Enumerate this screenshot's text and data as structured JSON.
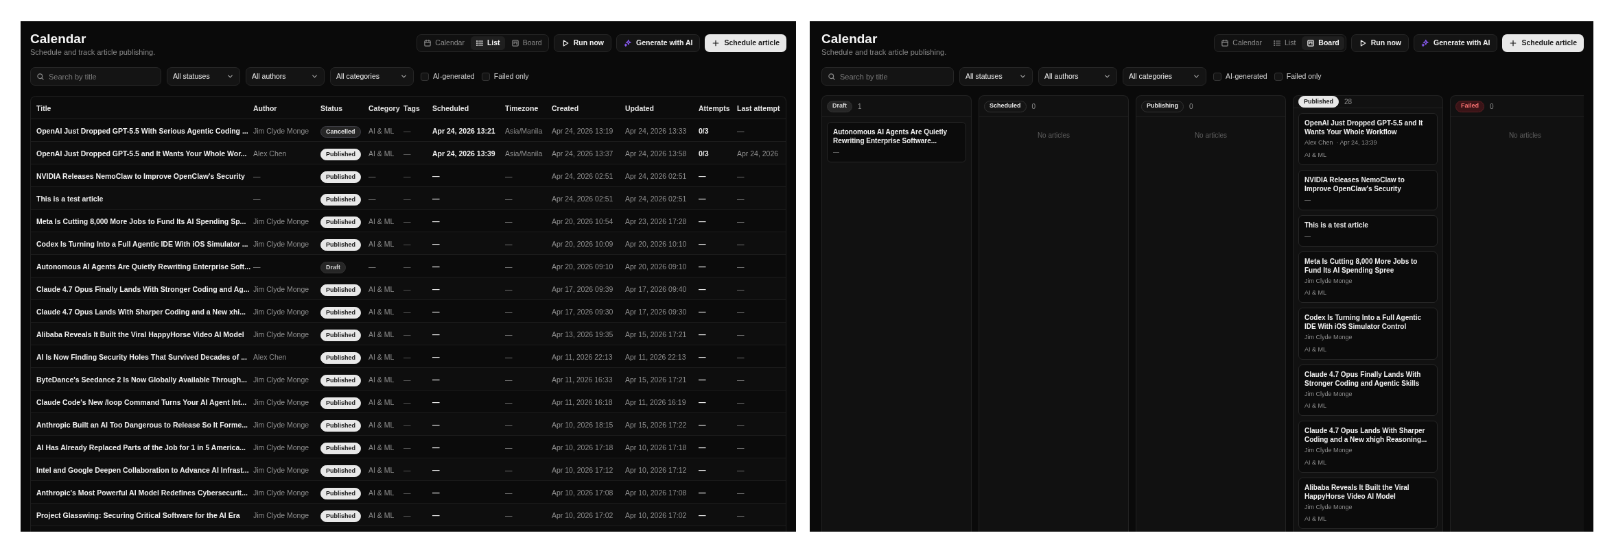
{
  "panels": [
    {
      "kind": "list",
      "header": {
        "title": "Calendar",
        "subtitle": "Schedule and track article publishing."
      },
      "view_tabs": [
        {
          "label": "Calendar",
          "selected": false
        },
        {
          "label": "List",
          "selected": true
        },
        {
          "label": "Board",
          "selected": false
        }
      ],
      "actions": [
        {
          "label": "Run now"
        },
        {
          "label": "Generate with AI"
        },
        {
          "label": "Schedule article"
        }
      ],
      "filters": {
        "search": {
          "placeholder": "Search by title"
        },
        "dropdowns": [
          {
            "value": "All statuses"
          },
          {
            "value": "All authors"
          },
          {
            "value": "All categories"
          }
        ],
        "checkboxes": [
          {
            "label": "AI-generated",
            "checked": false
          },
          {
            "label": "Failed only",
            "checked": false
          }
        ]
      },
      "table": {
        "columns": [
          "Title",
          "Author",
          "Status",
          "Category",
          "Tags",
          "Scheduled",
          "Timezone",
          "Created",
          "Updated",
          "Attempts",
          "Last attempt"
        ],
        "rows": [
          {
            "title": "OpenAI Just Dropped GPT-5.5 With Serious Agentic Coding ...",
            "author": "Jim Clyde Monge",
            "status": {
              "label": "Cancelled",
              "kind": "cancelled"
            },
            "category": "AI & ML",
            "tags": "—",
            "scheduled": "Apr 24, 2026 13:21",
            "timezone": "Asia/Manila",
            "created": "Apr 24, 2026 13:19",
            "updated": "Apr 24, 2026 13:33",
            "attempts": "0/3",
            "last_attempt": "—"
          },
          {
            "title": "OpenAI Just Dropped GPT-5.5 and It Wants Your Whole Wor...",
            "author": "Alex Chen",
            "status": {
              "label": "Published",
              "kind": "published"
            },
            "category": "AI & ML",
            "tags": "—",
            "scheduled": "Apr 24, 2026 13:39",
            "timezone": "Asia/Manila",
            "created": "Apr 24, 2026 13:37",
            "updated": "Apr 24, 2026 13:58",
            "attempts": "0/3",
            "last_attempt": "Apr 24, 2026"
          },
          {
            "title": "NVIDIA Releases NemoClaw to Improve OpenClaw's Security",
            "author": "—",
            "status": {
              "label": "Published",
              "kind": "published"
            },
            "category": "—",
            "tags": "—",
            "scheduled": "—",
            "timezone": "—",
            "created": "Apr 24, 2026 02:51",
            "updated": "Apr 24, 2026 02:51",
            "attempts": "—",
            "last_attempt": "—"
          },
          {
            "title": "This is a test article",
            "author": "—",
            "status": {
              "label": "Published",
              "kind": "published"
            },
            "category": "—",
            "tags": "—",
            "scheduled": "—",
            "timezone": "—",
            "created": "Apr 24, 2026 02:51",
            "updated": "Apr 24, 2026 02:51",
            "attempts": "—",
            "last_attempt": "—"
          },
          {
            "title": "Meta Is Cutting 8,000 More Jobs to Fund Its AI Spending Sp...",
            "author": "Jim Clyde Monge",
            "status": {
              "label": "Published",
              "kind": "published"
            },
            "category": "AI & ML",
            "tags": "—",
            "scheduled": "—",
            "timezone": "—",
            "created": "Apr 20, 2026 10:54",
            "updated": "Apr 23, 2026 17:28",
            "attempts": "—",
            "last_attempt": "—"
          },
          {
            "title": "Codex Is Turning Into a Full Agentic IDE With iOS Simulator ...",
            "author": "Jim Clyde Monge",
            "status": {
              "label": "Published",
              "kind": "published"
            },
            "category": "AI & ML",
            "tags": "—",
            "scheduled": "—",
            "timezone": "—",
            "created": "Apr 20, 2026 10:09",
            "updated": "Apr 20, 2026 10:10",
            "attempts": "—",
            "last_attempt": "—"
          },
          {
            "title": "Autonomous AI Agents Are Quietly Rewriting Enterprise Soft...",
            "author": "—",
            "status": {
              "label": "Draft",
              "kind": "draft"
            },
            "category": "—",
            "tags": "—",
            "scheduled": "—",
            "timezone": "—",
            "created": "Apr 20, 2026 09:10",
            "updated": "Apr 20, 2026 09:10",
            "attempts": "—",
            "last_attempt": "—"
          },
          {
            "title": "Claude 4.7 Opus Finally Lands With Stronger Coding and Ag...",
            "author": "Jim Clyde Monge",
            "status": {
              "label": "Published",
              "kind": "published"
            },
            "category": "AI & ML",
            "tags": "—",
            "scheduled": "—",
            "timezone": "—",
            "created": "Apr 17, 2026 09:39",
            "updated": "Apr 17, 2026 09:40",
            "attempts": "—",
            "last_attempt": "—"
          },
          {
            "title": "Claude 4.7 Opus Lands With Sharper Coding and a New xhi...",
            "author": "Jim Clyde Monge",
            "status": {
              "label": "Published",
              "kind": "published"
            },
            "category": "AI & ML",
            "tags": "—",
            "scheduled": "—",
            "timezone": "—",
            "created": "Apr 17, 2026 09:30",
            "updated": "Apr 17, 2026 09:30",
            "attempts": "—",
            "last_attempt": "—"
          },
          {
            "title": "Alibaba Reveals It Built the Viral HappyHorse Video AI Model",
            "author": "Jim Clyde Monge",
            "status": {
              "label": "Published",
              "kind": "published"
            },
            "category": "AI & ML",
            "tags": "—",
            "scheduled": "—",
            "timezone": "—",
            "created": "Apr 13, 2026 19:35",
            "updated": "Apr 15, 2026 17:21",
            "attempts": "—",
            "last_attempt": "—"
          },
          {
            "title": "AI Is Now Finding Security Holes That Survived Decades of ...",
            "author": "Alex Chen",
            "status": {
              "label": "Published",
              "kind": "published"
            },
            "category": "AI & ML",
            "tags": "—",
            "scheduled": "—",
            "timezone": "—",
            "created": "Apr 11, 2026 22:13",
            "updated": "Apr 11, 2026 22:13",
            "attempts": "—",
            "last_attempt": "—"
          },
          {
            "title": "ByteDance's Seedance 2 Is Now Globally Available Through...",
            "author": "Jim Clyde Monge",
            "status": {
              "label": "Published",
              "kind": "published"
            },
            "category": "AI & ML",
            "tags": "—",
            "scheduled": "—",
            "timezone": "—",
            "created": "Apr 11, 2026 16:33",
            "updated": "Apr 15, 2026 17:21",
            "attempts": "—",
            "last_attempt": "—"
          },
          {
            "title": "Claude Code's New /loop Command Turns Your AI Agent Int...",
            "author": "Jim Clyde Monge",
            "status": {
              "label": "Published",
              "kind": "published"
            },
            "category": "AI & ML",
            "tags": "—",
            "scheduled": "—",
            "timezone": "—",
            "created": "Apr 11, 2026 16:18",
            "updated": "Apr 11, 2026 16:19",
            "attempts": "—",
            "last_attempt": "—"
          },
          {
            "title": "Anthropic Built an AI Too Dangerous to Release So It Forme...",
            "author": "Jim Clyde Monge",
            "status": {
              "label": "Published",
              "kind": "published"
            },
            "category": "AI & ML",
            "tags": "—",
            "scheduled": "—",
            "timezone": "—",
            "created": "Apr 10, 2026 18:15",
            "updated": "Apr 15, 2026 17:22",
            "attempts": "—",
            "last_attempt": "—"
          },
          {
            "title": "AI Has Already Replaced Parts of the Job for 1 in 5 America...",
            "author": "Jim Clyde Monge",
            "status": {
              "label": "Published",
              "kind": "published"
            },
            "category": "AI & ML",
            "tags": "—",
            "scheduled": "—",
            "timezone": "—",
            "created": "Apr 10, 2026 17:18",
            "updated": "Apr 10, 2026 17:18",
            "attempts": "—",
            "last_attempt": "—"
          },
          {
            "title": "Intel and Google Deepen Collaboration to Advance AI Infrast...",
            "author": "Jim Clyde Monge",
            "status": {
              "label": "Published",
              "kind": "published"
            },
            "category": "AI & ML",
            "tags": "—",
            "scheduled": "—",
            "timezone": "—",
            "created": "Apr 10, 2026 17:12",
            "updated": "Apr 10, 2026 17:12",
            "attempts": "—",
            "last_attempt": "—"
          },
          {
            "title": "Anthropic's Most Powerful AI Model Redefines Cybersecurit...",
            "author": "Jim Clyde Monge",
            "status": {
              "label": "Published",
              "kind": "published"
            },
            "category": "AI & ML",
            "tags": "—",
            "scheduled": "—",
            "timezone": "—",
            "created": "Apr 10, 2026 17:08",
            "updated": "Apr 10, 2026 17:08",
            "attempts": "—",
            "last_attempt": "—"
          },
          {
            "title": "Project Glasswing: Securing Critical Software for the AI Era",
            "author": "Jim Clyde Monge",
            "status": {
              "label": "Published",
              "kind": "published"
            },
            "category": "AI & ML",
            "tags": "—",
            "scheduled": "—",
            "timezone": "—",
            "created": "Apr 10, 2026 17:02",
            "updated": "Apr 10, 2026 17:02",
            "attempts": "—",
            "last_attempt": "—"
          }
        ]
      }
    },
    {
      "kind": "board",
      "header": {
        "title": "Calendar",
        "subtitle": "Schedule and track article publishing."
      },
      "view_tabs": [
        {
          "label": "Calendar",
          "selected": false
        },
        {
          "label": "List",
          "selected": false
        },
        {
          "label": "Board",
          "selected": true
        }
      ],
      "actions": [
        {
          "label": "Run now"
        },
        {
          "label": "Generate with AI"
        },
        {
          "label": "Schedule article"
        }
      ],
      "filters": {
        "search": {
          "placeholder": "Search by title"
        },
        "dropdowns": [
          {
            "value": "All statuses"
          },
          {
            "value": "All authors"
          },
          {
            "value": "All categories"
          }
        ],
        "checkboxes": [
          {
            "label": "AI-generated",
            "checked": false
          },
          {
            "label": "Failed only",
            "checked": false
          }
        ]
      },
      "board": {
        "columns": [
          {
            "label": "Draft",
            "kind": "draft",
            "count": "1",
            "cards": [
              {
                "title": "Autonomous AI Agents Are Quietly Rewriting Enterprise Software...",
                "lines": [
                  "—"
                ]
              }
            ]
          },
          {
            "label": "Scheduled",
            "kind": "scheduled",
            "count": "0",
            "empty_text": "No articles"
          },
          {
            "label": "Publishing",
            "kind": "publishing",
            "count": "0",
            "empty_text": "No articles"
          },
          {
            "label": "Published",
            "kind": "published",
            "count": "28",
            "cards": [
              {
                "title": "OpenAI Just Dropped GPT-5.5 and It Wants Your Whole Workflow",
                "author": "Alex Chen",
                "date": "· Apr 24, 13:39",
                "lines": [
                  "AI & ML"
                ]
              },
              {
                "title": "NVIDIA Releases NemoClaw to Improve OpenClaw's Security",
                "lines": [
                  "—"
                ]
              },
              {
                "title": "This is a test article",
                "lines": [
                  "—"
                ]
              },
              {
                "title": "Meta Is Cutting 8,000 More Jobs to Fund Its AI Spending Spree",
                "author": "Jim Clyde Monge",
                "lines": [
                  "AI & ML"
                ]
              },
              {
                "title": "Codex Is Turning Into a Full Agentic IDE With iOS Simulator Control",
                "author": "Jim Clyde Monge",
                "lines": [
                  "AI & ML"
                ]
              },
              {
                "title": "Claude 4.7 Opus Finally Lands With Stronger Coding and Agentic Skills",
                "author": "Jim Clyde Monge",
                "lines": [
                  "AI & ML"
                ]
              },
              {
                "title": "Claude 4.7 Opus Lands With Sharper Coding and a New xhigh Reasoning...",
                "author": "Jim Clyde Monge",
                "lines": [
                  "AI & ML"
                ]
              },
              {
                "title": "Alibaba Reveals It Built the Viral HappyHorse Video AI Model",
                "author": "Jim Clyde Monge",
                "lines": [
                  "AI & ML"
                ]
              }
            ]
          },
          {
            "label": "Failed",
            "kind": "failed",
            "count": "0",
            "empty_text": "No articles"
          }
        ]
      }
    }
  ]
}
